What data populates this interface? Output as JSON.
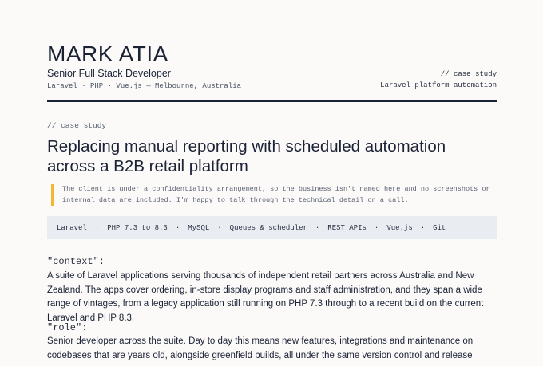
{
  "header": {
    "name": "MARK ATIA",
    "role": "Senior Full Stack Developer",
    "stack_line": "Laravel · PHP · Vue.js — Melbourne, Australia",
    "right_label": "// case study",
    "right_subtitle": "Laravel platform automation"
  },
  "case": {
    "eyebrow": "// case study",
    "title": "Replacing manual reporting with scheduled automation across a B2B retail platform",
    "note": "The client is under a confidentiality arrangement, so the business isn't named here and no screenshots or internal data are included. I'm happy to talk through the technical detail on a call.",
    "tech": [
      "Laravel",
      "PHP 7.3 to 8.3",
      "MySQL",
      "Queues & scheduler",
      "REST APIs",
      "Vue.js",
      "Git"
    ],
    "tech_separator": "·"
  },
  "sections": {
    "context": {
      "label": "\"context\":",
      "body": "A suite of Laravel applications serving thousands of independent retail partners across Australia and New Zealand. The apps cover ordering, in-store display programs and staff administration, and they span a wide range of vintages, from a legacy application still running on PHP 7.3 through to a recent build on the current Laravel and PHP 8.3."
    },
    "role": {
      "label": "\"role\":",
      "body": "Senior developer across the suite. Day to day this means new features, integrations and maintenance on codebases that are years old, alongside greenfield builds, all under the same version control and release process."
    }
  },
  "colors": {
    "ink": "#1b2236",
    "accent_bar": "#f2b632",
    "tech_bg": "#e9edf2",
    "page_bg": "#fbfaf8"
  }
}
